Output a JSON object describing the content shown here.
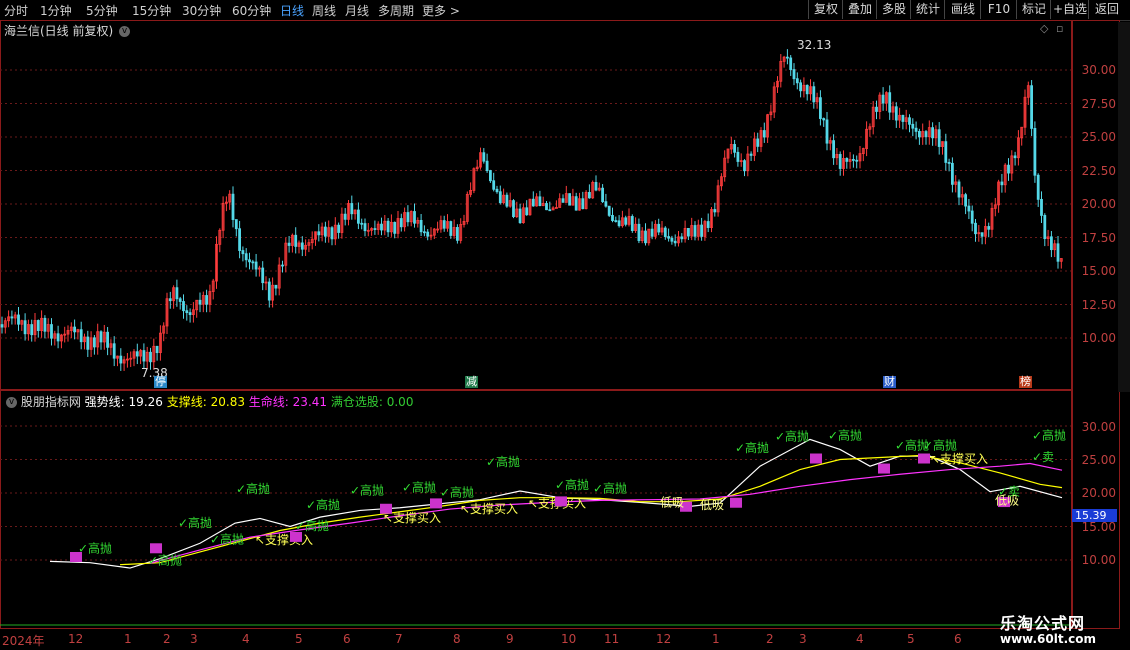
{
  "toolbar": {
    "periods": [
      "分时",
      "1分钟",
      "5分钟",
      "15分钟",
      "30分钟",
      "60分钟",
      "日线",
      "周线",
      "月线",
      "多周期",
      "更多 >"
    ],
    "active_period": "日线",
    "buttons": [
      "复权",
      "叠加",
      "多股",
      "统计",
      "画线",
      "F10",
      "标记",
      "+自选",
      "返回"
    ]
  },
  "chart_title": "海兰信(日线 前复权)",
  "price_axis": [
    "30.00",
    "27.50",
    "25.00",
    "22.50",
    "20.00",
    "17.50",
    "15.00",
    "12.50",
    "10.00"
  ],
  "high_label": "32.13",
  "low_label": "7.38",
  "event_markers": [
    "停",
    "减",
    "财",
    "榜"
  ],
  "indicator": {
    "name": "股朋指标网",
    "items": [
      {
        "label": "强势线:",
        "value": "19.26",
        "color": "#ffffff"
      },
      {
        "label": "支撑线:",
        "value": "20.83",
        "color": "#ffff00"
      },
      {
        "label": "生命线:",
        "value": "23.41",
        "color": "#ff33ff"
      },
      {
        "label": "满仓选股:",
        "value": "0.00",
        "color": "#33cc33"
      }
    ],
    "axis": [
      "30.00",
      "25.00",
      "20.00",
      "15.00",
      "10.00"
    ],
    "current_value": "15.39",
    "tags": {
      "gao": "高抛",
      "support": "支撑买入",
      "low_suck": "低吸",
      "sell": "卖",
      "chase": "追",
      "high": "高",
      "low": "低"
    }
  },
  "date_axis": [
    "2024年",
    "12",
    "1",
    "2",
    "3",
    "4",
    "5",
    "6",
    "7",
    "8",
    "9",
    "10",
    "11",
    "12",
    "1",
    "2",
    "3",
    "4",
    "5",
    "6"
  ],
  "watermark": {
    "line1": "乐淘公式网",
    "line2": "www.60lt.com"
  },
  "colors": {
    "up": "#ff3c3c",
    "down": "#54d8e8",
    "frame": "#8b1a1a",
    "grid": "#6a1a1a"
  }
}
